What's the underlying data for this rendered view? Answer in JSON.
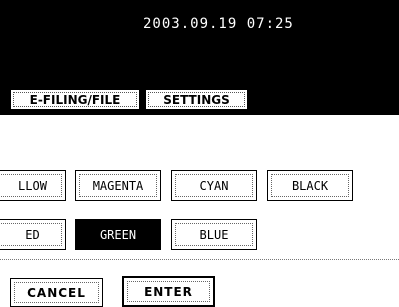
{
  "header": {
    "datetime": "2003.09.19 07:25"
  },
  "tabs": [
    {
      "label": "E-FILING/FILE"
    },
    {
      "label": "SETTINGS"
    }
  ],
  "colors": {
    "row1": [
      "LLOW",
      "MAGENTA",
      "CYAN",
      "BLACK"
    ],
    "row2": [
      "ED",
      "GREEN",
      "BLUE"
    ],
    "selected": "GREEN"
  },
  "actions": {
    "cancel_label": "CANCEL",
    "enter_label": "ENTER"
  }
}
